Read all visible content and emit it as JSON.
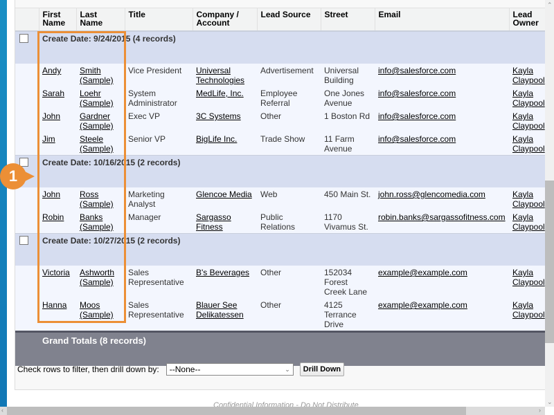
{
  "columns": [
    "",
    "First Name",
    "Last Name",
    "Title",
    "Company / Account",
    "Lead Source",
    "Street",
    "Email",
    "Lead Owner"
  ],
  "groups": [
    {
      "label": "Create Date: 9/24/2015 (4 records)",
      "records": [
        {
          "first": "Andy",
          "last": "Smith (Sample)",
          "title": "Vice President",
          "company": "Universal Technologies",
          "source": "Advertisement",
          "street": "Universal Building",
          "email": "info@salesforce.com",
          "owner": "Kayla Claypool"
        },
        {
          "first": "Sarah",
          "last": "Loehr (Sample)",
          "title": "System Administrator",
          "company": "MedLife, Inc.",
          "source": "Employee Referral",
          "street": "One Jones Avenue",
          "email": "info@salesforce.com",
          "owner": "Kayla Claypool"
        },
        {
          "first": "John",
          "last": "Gardner (Sample)",
          "title": "Exec VP",
          "company": "3C Systems",
          "source": "Other",
          "street": "1 Boston Rd",
          "email": "info@salesforce.com",
          "owner": "Kayla Claypool"
        },
        {
          "first": "Jim",
          "last": "Steele (Sample)",
          "title": "Senior VP",
          "company": "BigLife Inc.",
          "source": "Trade Show",
          "street": "11 Farm Avenue",
          "email": "info@salesforce.com",
          "owner": "Kayla Claypool"
        }
      ]
    },
    {
      "label": "Create Date: 10/16/2015 (2 records)",
      "records": [
        {
          "first": "John",
          "last": "Ross (Sample)",
          "title": "Marketing Analyst",
          "company": "Glencoe Media",
          "source": "Web",
          "street": "450 Main St.",
          "email": "john.ross@glencomedia.com",
          "owner": "Kayla Claypool"
        },
        {
          "first": "Robin",
          "last": "Banks (Sample)",
          "title": "Manager",
          "company": "Sargasso Fitness",
          "source": "Public Relations",
          "street": "1170 Vivamus St.",
          "email": "robin.banks@sargassofitness.com",
          "owner": "Kayla Claypool"
        }
      ]
    },
    {
      "label": "Create Date: 10/27/2015 (2 records)",
      "records": [
        {
          "first": "Victoria",
          "last": "Ashworth (Sample)",
          "title": "Sales Representative",
          "company": "B's Beverages",
          "source": "Other",
          "street": "152034 Forest Creek Lane",
          "email": "example@example.com",
          "owner": "Kayla Claypool"
        },
        {
          "first": "Hanna",
          "last": "Moos (Sample)",
          "title": "Sales Representative",
          "company": "Blauer See Delikatessen",
          "source": "Other",
          "street": "4125 Terrance Drive",
          "email": "example@example.com",
          "owner": "Kayla Claypool"
        }
      ]
    }
  ],
  "grand_total": "Grand Totals (8 records)",
  "drill": {
    "label": "Check rows to filter, then drill down by:",
    "selected": "--None--",
    "button": "Drill Down"
  },
  "footer": "Confidential Information - Do Not Distribute",
  "callout": {
    "number": "1",
    "color": "#ec8f36"
  }
}
